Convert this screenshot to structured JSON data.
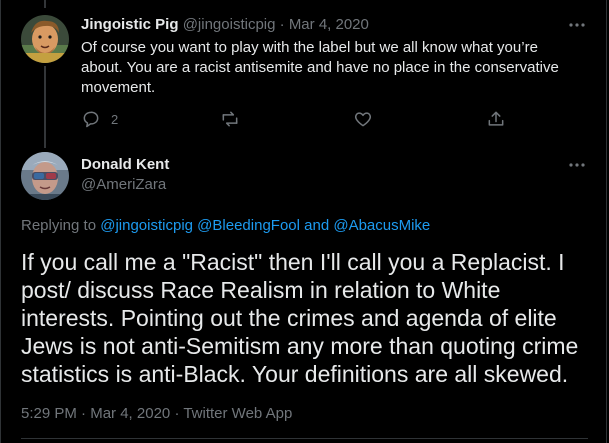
{
  "parent_tweet": {
    "display_name": "Jingoistic Pig",
    "handle": "@jingoisticpig",
    "separator": "·",
    "date": "Mar 4, 2020",
    "text": "Of course you want to play with the label but we all know what you’re about. You are a racist antisemite and have no place in the conservative movement.",
    "reply_count": "2",
    "avatar_icon": "cartoon-avatar-icon"
  },
  "main_tweet": {
    "display_name": "Donald Kent",
    "handle": "@AmeriZara",
    "replying_prefix": "Replying to",
    "replying_to_1": "@jingoisticpig",
    "replying_to_2": "@BleedingFool",
    "replying_and": "and",
    "replying_to_3": "@AbacusMike",
    "text": "If you call me a \"Racist\" then I'll call you a Replacist. I post/ discuss Race Realism in relation to White interests. Pointing out the crimes and agenda of elite Jews is not anti-Semitism any more than quoting crime statistics is anti-Black. Your definitions are all skewed.",
    "time": "5:29 PM",
    "separator": "·",
    "date": "Mar 4, 2020",
    "client": "Twitter Web App",
    "avatar_icon": "photo-avatar-icon"
  },
  "colors": {
    "background": "#000000",
    "text": "#e7e9ea",
    "muted": "#71767b",
    "link": "#1d9bf0",
    "border": "#2f3336"
  }
}
